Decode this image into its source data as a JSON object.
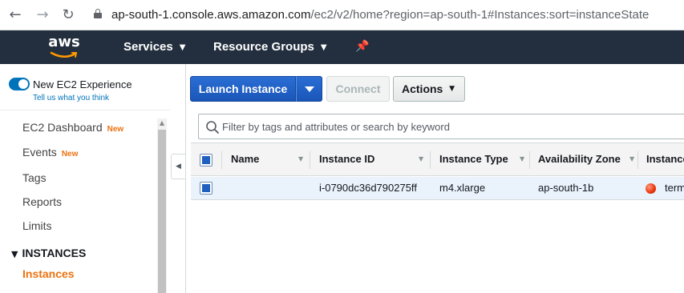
{
  "browser": {
    "url_host": "ap-south-1.console.aws.amazon.com",
    "url_path": "/ec2/v2/home?region=ap-south-1#Instances:sort=instanceState"
  },
  "aws_nav": {
    "logo": "aws",
    "services": "Services",
    "resource_groups": "Resource Groups"
  },
  "sidebar": {
    "experience_label": "New EC2 Experience",
    "experience_link": "Tell us what you think",
    "items": [
      {
        "label": "EC2 Dashboard",
        "badge": "New"
      },
      {
        "label": "Events",
        "badge": "New"
      },
      {
        "label": "Tags",
        "badge": ""
      },
      {
        "label": "Reports",
        "badge": ""
      },
      {
        "label": "Limits",
        "badge": ""
      }
    ],
    "section": "INSTANCES",
    "active_item": "Instances"
  },
  "toolbar": {
    "launch_label": "Launch Instance",
    "connect_label": "Connect",
    "actions_label": "Actions"
  },
  "filter": {
    "placeholder": "Filter by tags and attributes or search by keyword"
  },
  "table": {
    "columns": [
      "Name",
      "Instance ID",
      "Instance Type",
      "Availability Zone",
      "Instance State"
    ],
    "rows": [
      {
        "name": "",
        "instance_id": "i-0790dc36d790275ff",
        "instance_type": "m4.xlarge",
        "availability_zone": "ap-south-1b",
        "instance_state": "terminated"
      }
    ]
  },
  "colors": {
    "aws_nav_bg": "#232f3e",
    "primary_button": "#1f5fbf",
    "active_link": "#ec7211",
    "state_terminated": "#e8340c"
  }
}
